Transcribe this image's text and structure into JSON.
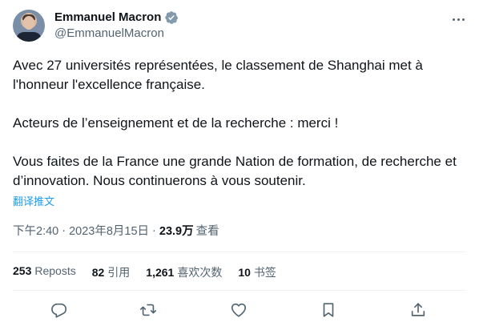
{
  "author": {
    "display_name": "Emmanuel Macron",
    "handle": "@EmmanuelMacron"
  },
  "tweet": {
    "paragraphs": [
      "Avec 27 universités représentées, le classement de Shanghai met à l'honneur l'excellence française.",
      "Acteurs de l’enseignement et de la recherche : merci !",
      "Vous faites de la France une grande Nation de formation, de recherche et d’innovation. Nous continuerons à vous soutenir."
    ],
    "translate_label": "翻译推文"
  },
  "meta": {
    "time": "下午2:40",
    "separator": "·",
    "date": "2023年8月15日",
    "views_count": "23.9万",
    "views_label": "查看"
  },
  "stats": {
    "reposts_count": "253",
    "reposts_label": "Reposts",
    "quotes_count": "82",
    "quotes_label": "引用",
    "likes_count": "1,261",
    "likes_label": "喜欢次数",
    "bookmarks_count": "10",
    "bookmarks_label": "书签"
  },
  "colors": {
    "text": "#0f1419",
    "secondary": "#536471",
    "accent": "#1d9bf0",
    "divider": "#eff3f4"
  },
  "icons": [
    "verified-badge-icon",
    "more-icon",
    "reply-icon",
    "retweet-icon",
    "like-icon",
    "bookmark-icon",
    "share-icon"
  ]
}
